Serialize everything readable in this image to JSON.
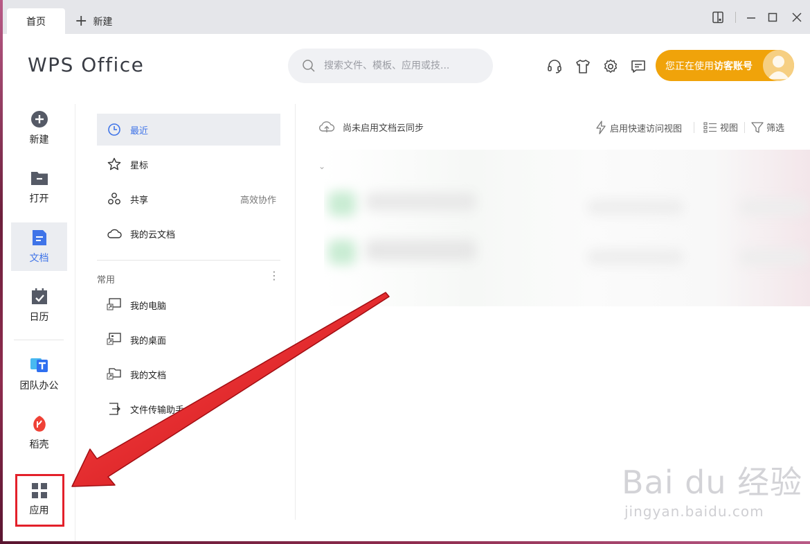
{
  "titlebar": {
    "tab_home": "首页",
    "tab_new": "新建"
  },
  "header": {
    "logo": "WPS Office",
    "search_placeholder": "搜索文件、模板、应用或技...",
    "account_prefix": "您正在使用",
    "account_type": "访客账号",
    "icons": [
      "headset-icon",
      "tshirt-icon",
      "gear-icon",
      "message-icon"
    ]
  },
  "leftnav": {
    "items": [
      {
        "label": "新建",
        "icon": "plus-circle-icon"
      },
      {
        "label": "打开",
        "icon": "folder-icon"
      },
      {
        "label": "文档",
        "icon": "document-icon",
        "active": true
      },
      {
        "label": "日历",
        "icon": "calendar-icon"
      },
      {
        "label": "团队办公",
        "icon": "team-icon"
      },
      {
        "label": "稻壳",
        "icon": "docer-icon"
      },
      {
        "label": "应用",
        "icon": "apps-grid-icon"
      }
    ]
  },
  "midpanel": {
    "items": [
      {
        "label": "最近",
        "icon": "clock-icon",
        "active": true
      },
      {
        "label": "星标",
        "icon": "star-icon"
      },
      {
        "label": "共享",
        "icon": "share-icon",
        "extra": "高效协作"
      },
      {
        "label": "我的云文档",
        "icon": "cloud-icon"
      }
    ],
    "section_title": "常用",
    "common": [
      {
        "label": "我的电脑",
        "icon": "computer-shortcut-icon"
      },
      {
        "label": "我的桌面",
        "icon": "desktop-shortcut-icon"
      },
      {
        "label": "我的文档",
        "icon": "documents-shortcut-icon"
      },
      {
        "label": "文件传输助手",
        "icon": "transfer-icon"
      }
    ]
  },
  "main": {
    "sync_text": "尚未启用文档云同步",
    "quick_access": "启用快速访问视图",
    "view": "视图",
    "filter": "筛选"
  },
  "watermark": {
    "main": "Bai du 经验",
    "sub": "jingyan.baidu.com"
  },
  "colors": {
    "accent_blue": "#3f74e8",
    "account_orange": "#f0a30a",
    "annotation_red": "#e3202a"
  }
}
